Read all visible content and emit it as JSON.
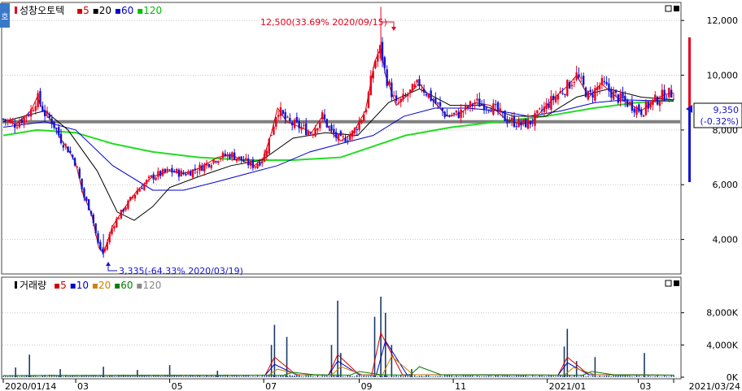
{
  "header": {
    "badge": "호",
    "stock_name": "성창오토텍",
    "ma_labels": [
      {
        "label": "5",
        "color": "#d40000"
      },
      {
        "label": "20",
        "color": "#000000"
      },
      {
        "label": "60",
        "color": "#0000cc"
      },
      {
        "label": "120",
        "color": "#00bb00"
      }
    ]
  },
  "volume_header": {
    "title": "거래량",
    "ma_labels": [
      {
        "label": "5",
        "color": "#d40000"
      },
      {
        "label": "10",
        "color": "#0000cc"
      },
      {
        "label": "20",
        "color": "#d08000"
      },
      {
        "label": "60",
        "color": "#008000"
      },
      {
        "label": "120",
        "color": "#888888"
      }
    ]
  },
  "annotations": {
    "high": "12,500(33.69% 2020/09/15)",
    "low": "3,335(-64.33% 2020/03/19)"
  },
  "current_price": {
    "price": "9,350",
    "change": "(-0.32%)"
  },
  "colors": {
    "up": "#e8001c",
    "down": "#1414d2",
    "ma5": "#d40000",
    "ma20": "#000000",
    "ma60": "#0000cc",
    "ma120": "#22dd22"
  },
  "chart_data": [
    {
      "type": "candlestick",
      "title": "성창오토텍",
      "y_ticks": [
        "4,000",
        "6,000",
        "8,000",
        "10,000",
        "12,000"
      ],
      "ylim": [
        2800,
        12600
      ],
      "x_ticks": [
        "2020/01/14",
        "03",
        "05",
        "07",
        "09",
        "11",
        "2021/01",
        "03",
        "2021/03/24"
      ],
      "series": [
        {
          "name": "5",
          "color": "#d40000"
        },
        {
          "name": "20",
          "color": "#000000"
        },
        {
          "name": "60",
          "color": "#0000cc"
        },
        {
          "name": "120",
          "color": "#00bb00"
        }
      ],
      "close_path": [
        [
          "2020/01/14",
          8400
        ],
        [
          "2020/01/22",
          8200
        ],
        [
          "2020/02/01",
          8700
        ],
        [
          "2020/02/05",
          9200
        ],
        [
          "2020/02/10",
          8600
        ],
        [
          "2020/02/15",
          8300
        ],
        [
          "2020/02/20",
          7700
        ],
        [
          "2020/02/25",
          7300
        ],
        [
          "2020/03/01",
          6800
        ],
        [
          "2020/03/06",
          5600
        ],
        [
          "2020/03/11",
          5000
        ],
        [
          "2020/03/16",
          3700
        ],
        [
          "2020/03/19",
          3500
        ],
        [
          "2020/03/25",
          4500
        ],
        [
          "2020/04/01",
          5100
        ],
        [
          "2020/04/10",
          5800
        ],
        [
          "2020/04/20",
          6300
        ],
        [
          "2020/05/01",
          6500
        ],
        [
          "2020/05/10",
          6400
        ],
        [
          "2020/05/20",
          6600
        ],
        [
          "2020/06/01",
          7000
        ],
        [
          "2020/06/10",
          7100
        ],
        [
          "2020/06/20",
          6800
        ],
        [
          "2020/06/25",
          6700
        ],
        [
          "2020/07/01",
          7000
        ],
        [
          "2020/07/06",
          7900
        ],
        [
          "2020/07/10",
          8800
        ],
        [
          "2020/07/16",
          8300
        ],
        [
          "2020/07/25",
          8100
        ],
        [
          "2020/08/01",
          7900
        ],
        [
          "2020/08/08",
          8500
        ],
        [
          "2020/08/14",
          7900
        ],
        [
          "2020/08/20",
          7600
        ],
        [
          "2020/08/28",
          7900
        ],
        [
          "2020/09/05",
          8700
        ],
        [
          "2020/09/11",
          10500
        ],
        [
          "2020/09/15",
          11000
        ],
        [
          "2020/09/18",
          10000
        ],
        [
          "2020/09/25",
          8900
        ],
        [
          "2020/10/01",
          9200
        ],
        [
          "2020/10/10",
          9700
        ],
        [
          "2020/10/20",
          9000
        ],
        [
          "2020/10/28",
          8500
        ],
        [
          "2020/11/05",
          8600
        ],
        [
          "2020/11/15",
          9000
        ],
        [
          "2020/11/25",
          8900
        ],
        [
          "2020/12/05",
          8400
        ],
        [
          "2020/12/15",
          8200
        ],
        [
          "2020/12/22",
          8300
        ],
        [
          "2020/12/30",
          8800
        ],
        [
          "2021/01/06",
          9200
        ],
        [
          "2021/01/14",
          9600
        ],
        [
          "2021/01/20",
          10000
        ],
        [
          "2021/01/28",
          9200
        ],
        [
          "2021/02/05",
          9700
        ],
        [
          "2021/02/15",
          9200
        ],
        [
          "2021/02/25",
          8900
        ],
        [
          "2021/03/03",
          8700
        ],
        [
          "2021/03/10",
          9000
        ],
        [
          "2021/03/18",
          9300
        ],
        [
          "2021/03/24",
          9350
        ]
      ],
      "ma20_path": [
        [
          "2020/01/14",
          8300
        ],
        [
          "2020/02/10",
          8700
        ],
        [
          "2020/02/25",
          8000
        ],
        [
          "2020/03/15",
          6500
        ],
        [
          "2020/03/28",
          5000
        ],
        [
          "2020/04/08",
          4700
        ],
        [
          "2020/04/20",
          5200
        ],
        [
          "2020/05/01",
          5900
        ],
        [
          "2020/05/20",
          6300
        ],
        [
          "2020/06/10",
          6700
        ],
        [
          "2020/06/30",
          6900
        ],
        [
          "2020/07/20",
          7700
        ],
        [
          "2020/08/10",
          7900
        ],
        [
          "2020/08/31",
          7800
        ],
        [
          "2020/09/20",
          9000
        ],
        [
          "2020/10/10",
          9500
        ],
        [
          "2020/10/30",
          8900
        ],
        [
          "2020/11/20",
          8900
        ],
        [
          "2020/12/10",
          8500
        ],
        [
          "2020/12/31",
          8500
        ],
        [
          "2021/01/20",
          9200
        ],
        [
          "2021/02/10",
          9500
        ],
        [
          "2021/03/03",
          9200
        ],
        [
          "2021/03/24",
          9100
        ]
      ],
      "ma60_path": [
        [
          "2020/01/14",
          8100
        ],
        [
          "2020/02/10",
          8300
        ],
        [
          "2020/03/01",
          8000
        ],
        [
          "2020/03/25",
          6700
        ],
        [
          "2020/04/20",
          5800
        ],
        [
          "2020/05/10",
          5800
        ],
        [
          "2020/05/31",
          6100
        ],
        [
          "2020/06/20",
          6400
        ],
        [
          "2020/07/10",
          6700
        ],
        [
          "2020/07/31",
          7200
        ],
        [
          "2020/08/20",
          7500
        ],
        [
          "2020/09/10",
          7800
        ],
        [
          "2020/09/30",
          8500
        ],
        [
          "2020/10/20",
          8800
        ],
        [
          "2020/11/10",
          8800
        ],
        [
          "2020/12/01",
          8700
        ],
        [
          "2020/12/20",
          8500
        ],
        [
          "2021/01/10",
          8700
        ],
        [
          "2021/02/01",
          9000
        ],
        [
          "2021/02/20",
          9100
        ],
        [
          "2021/03/24",
          9050
        ]
      ],
      "ma120_path": [
        [
          "2020/01/14",
          7800
        ],
        [
          "2020/02/05",
          8000
        ],
        [
          "2020/03/01",
          7900
        ],
        [
          "2020/03/25",
          7500
        ],
        [
          "2020/04/20",
          7200
        ],
        [
          "2020/05/20",
          7000
        ],
        [
          "2020/06/20",
          6900
        ],
        [
          "2020/07/20",
          6900
        ],
        [
          "2020/08/20",
          7000
        ],
        [
          "2020/09/10",
          7400
        ],
        [
          "2020/10/01",
          7800
        ],
        [
          "2020/10/31",
          8100
        ],
        [
          "2020/11/30",
          8300
        ],
        [
          "2020/12/31",
          8500
        ],
        [
          "2021/01/31",
          8800
        ],
        [
          "2021/02/28",
          9000
        ],
        [
          "2021/03/24",
          9100
        ]
      ],
      "reference_line": 8300,
      "current_price": 9350
    },
    {
      "type": "bar",
      "title": "거래량",
      "y_ticks": [
        "0K",
        "4,000K",
        "8,000K"
      ],
      "ylim": [
        0,
        11000
      ],
      "unit": "K",
      "spikes": [
        [
          "2020/01/22",
          1200
        ],
        [
          "2020/01/31",
          2800
        ],
        [
          "2020/02/20",
          1000
        ],
        [
          "2020/03/19",
          1300
        ],
        [
          "2020/04/10",
          900
        ],
        [
          "2020/05/01",
          1500
        ],
        [
          "2020/06/01",
          800
        ],
        [
          "2020/07/06",
          4000
        ],
        [
          "2020/07/08",
          6500
        ],
        [
          "2020/07/16",
          5000
        ],
        [
          "2020/08/14",
          4000
        ],
        [
          "2020/08/18",
          9500
        ],
        [
          "2020/08/20",
          3000
        ],
        [
          "2020/09/11",
          7500
        ],
        [
          "2020/09/15",
          10000
        ],
        [
          "2020/09/18",
          8000
        ],
        [
          "2020/09/22",
          4000
        ],
        [
          "2020/10/05",
          1000
        ],
        [
          "2021/01/12",
          3800
        ],
        [
          "2021/01/14",
          6000
        ],
        [
          "2021/01/20",
          2000
        ],
        [
          "2021/02/01",
          2500
        ],
        [
          "2021/03/05",
          3000
        ]
      ],
      "ma_traces": [
        {
          "name": "5",
          "color": "#d40000",
          "points": [
            [
              "2020/07/08",
              2500
            ],
            [
              "2020/08/18",
              2800
            ],
            [
              "2020/09/15",
              5500
            ],
            [
              "2021/01/14",
              2500
            ]
          ]
        },
        {
          "name": "10",
          "color": "#0000cc",
          "points": [
            [
              "2020/07/08",
              1600
            ],
            [
              "2020/08/18",
              2000
            ],
            [
              "2020/09/18",
              4500
            ],
            [
              "2021/01/14",
              1800
            ]
          ]
        },
        {
          "name": "20",
          "color": "#d08000",
          "points": [
            [
              "2020/07/10",
              1000
            ],
            [
              "2020/08/20",
              1300
            ],
            [
              "2020/09/22",
              2600
            ],
            [
              "2021/01/18",
              1200
            ]
          ]
        },
        {
          "name": "60",
          "color": "#008000",
          "points": [
            [
              "2020/07/20",
              600
            ],
            [
              "2020/09/01",
              700
            ],
            [
              "2020/10/10",
              1300
            ],
            [
              "2021/01/30",
              700
            ]
          ]
        }
      ]
    }
  ]
}
